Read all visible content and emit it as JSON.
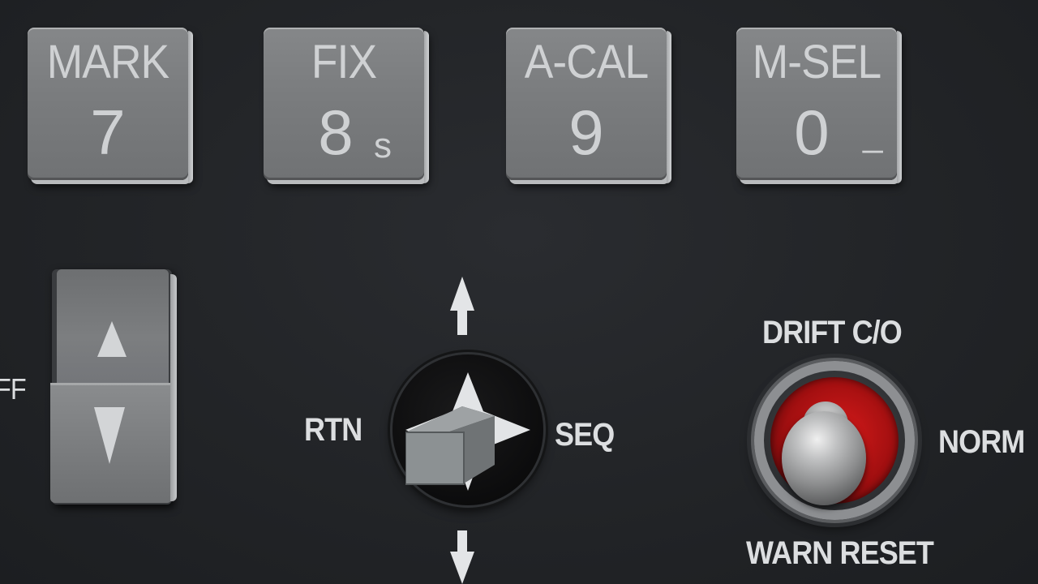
{
  "keypad": {
    "keys": [
      {
        "label": "MARK",
        "number": "7",
        "sub": ""
      },
      {
        "label": "FIX",
        "number": "8",
        "sub": "s"
      },
      {
        "label": "A-CAL",
        "number": "9",
        "sub": ""
      },
      {
        "label": "M-SEL",
        "number": "0",
        "sub": "_"
      }
    ]
  },
  "rocker": {
    "side_label": "FF",
    "up_icon": "triangle-up-icon",
    "down_icon": "triangle-down-icon"
  },
  "joystick": {
    "left_label": "RTN",
    "right_label": "SEQ",
    "up_icon": "arrow-up-icon",
    "down_icon": "arrow-down-icon"
  },
  "drift_switch": {
    "top_label": "DRIFT C/O",
    "right_label": "NORM",
    "bottom_label": "WARN RESET",
    "accent_color": "#c41515"
  }
}
